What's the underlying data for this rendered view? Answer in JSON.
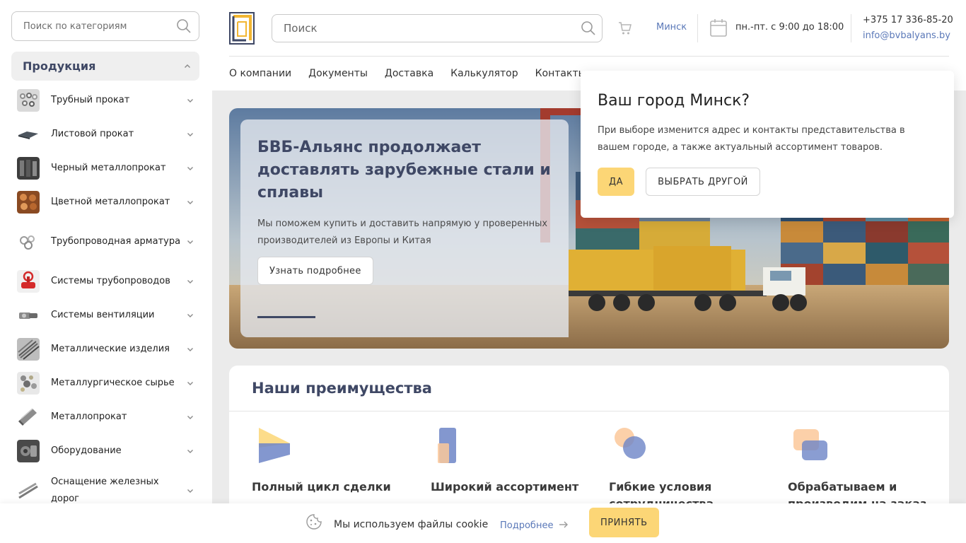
{
  "sidebar": {
    "search": {
      "placeholder": "Поиск по категориям"
    },
    "products_heading": "Продукция",
    "categories": [
      {
        "label": "Трубный прокат",
        "thumb_icon": "pipes-icon"
      },
      {
        "label": "Листовой прокат",
        "thumb_icon": "sheet-metal-icon"
      },
      {
        "label": "Черный металлопрокат",
        "thumb_icon": "ferrous-metal-icon"
      },
      {
        "label": "Цветной металлопрокат",
        "thumb_icon": "nonferrous-metal-icon"
      },
      {
        "label": "Трубопроводная арматура",
        "thumb_icon": "pipe-fittings-icon"
      },
      {
        "label": "Системы трубопроводов",
        "thumb_icon": "valve-icon"
      },
      {
        "label": "Системы вентиляции",
        "thumb_icon": "ventilation-icon"
      },
      {
        "label": "Металлические изделия",
        "thumb_icon": "metal-products-icon"
      },
      {
        "label": "Металлургическое сырье",
        "thumb_icon": "raw-materials-icon"
      },
      {
        "label": "Металлопрокат",
        "thumb_icon": "rolled-metal-icon"
      },
      {
        "label": "Оборудование",
        "thumb_icon": "equipment-icon"
      },
      {
        "label": "Оснащение железных дорог",
        "thumb_icon": "railway-icon"
      }
    ]
  },
  "header": {
    "search": {
      "placeholder": "Поиск"
    },
    "city": "Минск",
    "hours": "пн.-пт. с 9:00 до 18:00",
    "phone": "+375 17 336-85-20",
    "email": "info@bvbalyans.by",
    "nav": [
      "О компании",
      "Документы",
      "Доставка",
      "Калькулятор",
      "Контакты"
    ]
  },
  "hero": {
    "title": "БВБ-Альянс продолжает доставлять зарубежные стали и сплавы",
    "text": "Мы поможем купить и доставить напрямую у проверенных производителей из Европы и Китая",
    "button": "Узнать подробнее"
  },
  "city_popup": {
    "title": "Ваш город Минск?",
    "text": "При выборе изменится адрес и контакты представительства в вашем городе, а также актуальный ассортимент товаров.",
    "yes": "ДА",
    "other": "ВЫБРАТЬ ДРУГОЙ"
  },
  "advantages": {
    "title": "Наши преимущества",
    "items": [
      {
        "label": "Полный цикл сделки"
      },
      {
        "label": "Широкий ассортимент"
      },
      {
        "label": "Гибкие условия сотрудничества"
      },
      {
        "label": "Обрабатываем и производим на заказ"
      }
    ]
  },
  "cookie": {
    "text": "Мы используем файлы cookie",
    "more": "Подробнее",
    "accept": "ПРИНЯТЬ"
  },
  "colors": {
    "accent_yellow": "#fcd676",
    "brand_navy": "#3f4865",
    "link_blue": "#5a78b8"
  }
}
